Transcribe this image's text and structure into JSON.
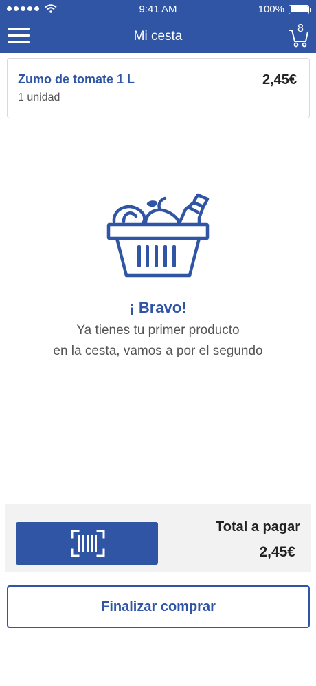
{
  "status_bar": {
    "time": "9:41 AM",
    "battery": "100%"
  },
  "navbar": {
    "title": "Mi cesta",
    "cart_count": "8"
  },
  "cart_item": {
    "name": "Zumo de tomate 1 L",
    "quantity": "1 unidad",
    "price": "2,45€"
  },
  "empty_message": {
    "title": "¡ Bravo!",
    "line1": "Ya tienes tu primer producto",
    "line2": "en la cesta, vamos a por el segundo"
  },
  "footer": {
    "total_label": "Total a pagar",
    "total_value": "2,45€"
  },
  "finalize_label": "Finalizar comprar",
  "colors": {
    "brand": "#2f55a4",
    "panel": "#f2f2f2"
  }
}
